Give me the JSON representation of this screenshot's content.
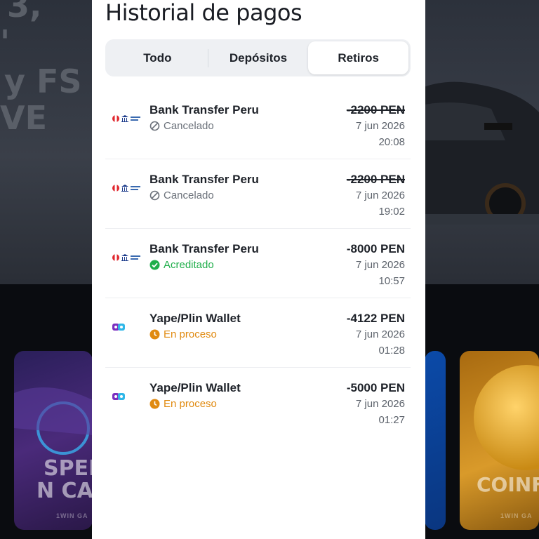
{
  "background": {
    "hero_lines": [
      "3,",
      "'",
      "y FS",
      "VE"
    ],
    "cards": [
      {
        "title_lines": [
          "SPEI",
          "N CA"
        ],
        "subtitle": "1WIN GA"
      },
      {
        "title_lines": [
          "COINF"
        ],
        "subtitle": "1WIN GA"
      }
    ]
  },
  "panel": {
    "title": "Historial de pagos",
    "tabs": [
      {
        "label": "Todo",
        "active": false
      },
      {
        "label": "Depósitos",
        "active": false
      },
      {
        "label": "Retiros",
        "active": true
      }
    ],
    "transactions": [
      {
        "method": "Bank Transfer Peru",
        "logo": "bank-transfer-peru-icon",
        "status": "Cancelado",
        "status_icon": "cancel-icon",
        "amount": "-2200 PEN",
        "date": "7 jun 2026",
        "time": "20:08"
      },
      {
        "method": "Bank Transfer Peru",
        "logo": "bank-transfer-peru-icon",
        "status": "Cancelado",
        "status_icon": "cancel-icon",
        "amount": "-2200 PEN",
        "date": "7 jun 2026",
        "time": "19:02"
      },
      {
        "method": "Bank Transfer Peru",
        "logo": "bank-transfer-peru-icon",
        "status": "Acreditado",
        "status_icon": "check-icon",
        "amount": "-8000 PEN",
        "date": "7 jun 2026",
        "time": "10:57"
      },
      {
        "method": "Yape/Plin Wallet",
        "logo": "yape-plin-icon",
        "status": "En proceso",
        "status_icon": "clock-icon",
        "amount": "-4122 PEN",
        "date": "7 jun 2026",
        "time": "01:28"
      },
      {
        "method": "Yape/Plin Wallet",
        "logo": "yape-plin-icon",
        "status": "En proceso",
        "status_icon": "clock-icon",
        "amount": "-5000 PEN",
        "date": "7 jun 2026",
        "time": "01:27"
      }
    ]
  },
  "colors": {
    "panel_bg": "#ffffff",
    "status_cancel": "#6b717a",
    "status_ok": "#1fae4a",
    "status_pending": "#e08a10"
  }
}
